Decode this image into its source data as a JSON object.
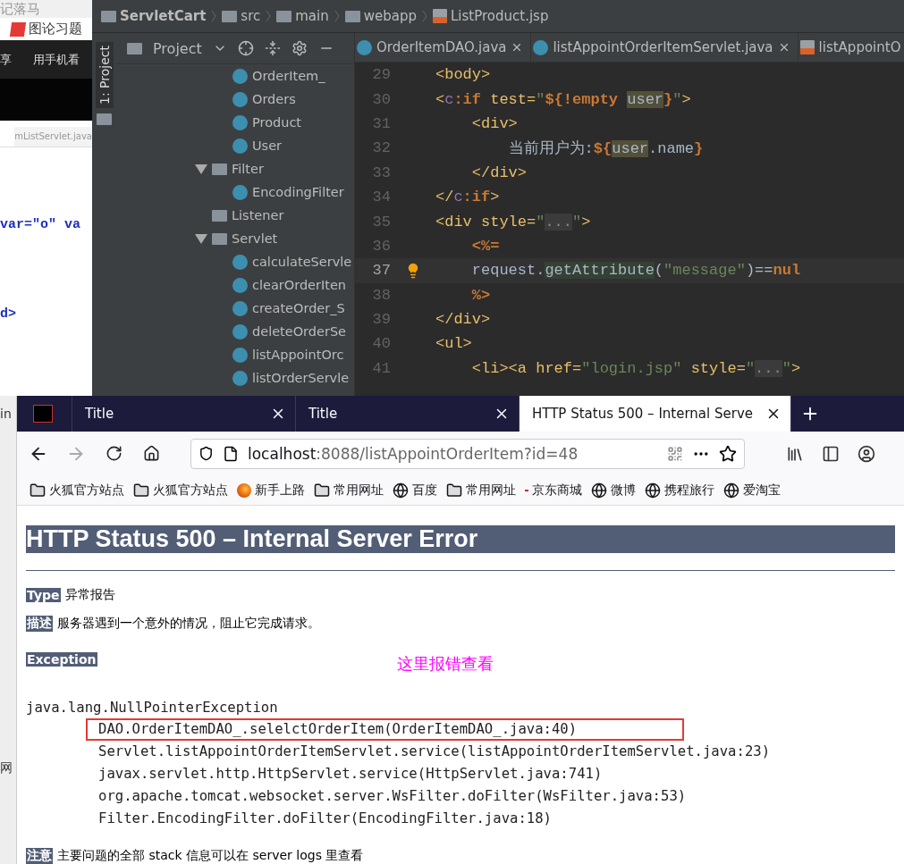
{
  "background_app": {
    "title_fragment": "记落马",
    "tab": "图论习题",
    "menu": [
      "享",
      "用手机看"
    ],
    "file_tab": "mListServlet.java",
    "code_lines": [
      "var=\"o\" va",
      "d>"
    ],
    "side_texts": [
      "in",
      "网"
    ]
  },
  "ide": {
    "breadcrumbs": [
      {
        "label": "ServletCart",
        "kind": "project"
      },
      {
        "label": "src",
        "kind": "folder"
      },
      {
        "label": "main",
        "kind": "folder"
      },
      {
        "label": "webapp",
        "kind": "web"
      },
      {
        "label": "ListProduct.jsp",
        "kind": "jsp"
      }
    ],
    "tool_window_tab": "1: Project",
    "project_panel": {
      "title": "Project",
      "tree": [
        {
          "label": "OrderItem_",
          "kind": "class"
        },
        {
          "label": "Orders",
          "kind": "class"
        },
        {
          "label": "Product",
          "kind": "class"
        },
        {
          "label": "User",
          "kind": "class"
        },
        {
          "label": "Filter",
          "kind": "folder",
          "expanded": true,
          "children": [
            {
              "label": "EncodingFilter",
              "kind": "class"
            }
          ]
        },
        {
          "label": "Listener",
          "kind": "folder"
        },
        {
          "label": "Servlet",
          "kind": "folder",
          "expanded": true,
          "children": [
            {
              "label": "calculateServle",
              "kind": "class"
            },
            {
              "label": "clearOrderIten",
              "kind": "class"
            },
            {
              "label": "createOrder_S",
              "kind": "class"
            },
            {
              "label": "deleteOrderSe",
              "kind": "class"
            },
            {
              "label": "listAppointOrc",
              "kind": "class"
            },
            {
              "label": "listOrderServle",
              "kind": "class"
            }
          ]
        }
      ]
    },
    "editor_tabs": [
      {
        "label": "OrderItemDAO.java",
        "kind": "class"
      },
      {
        "label": "listAppointOrderItemServlet.java",
        "kind": "class"
      },
      {
        "label": "listAppointO",
        "kind": "jsp"
      }
    ],
    "code": [
      {
        "number": "29",
        "current": false,
        "tokens": [
          {
            "kind": "tag",
            "t": "<body>"
          }
        ]
      },
      {
        "number": "30",
        "current": false,
        "tokens": [
          {
            "kind": "tag",
            "t": "<"
          },
          {
            "kind": "ns",
            "t": "c"
          },
          {
            "kind": "kw",
            "t": ":if"
          },
          {
            "kind": "tag",
            "t": " test="
          },
          {
            "kind": "str",
            "t": "\""
          },
          {
            "kind": "kw",
            "t": "${!empty "
          },
          {
            "kind": "hl",
            "t": "user"
          },
          {
            "kind": "kw",
            "t": "}"
          },
          {
            "kind": "str",
            "t": "\""
          },
          {
            "kind": "tag",
            "t": ">"
          }
        ]
      },
      {
        "number": "31",
        "current": false,
        "tokens": [
          {
            "kind": "tag",
            "t": "    <div>"
          }
        ]
      },
      {
        "number": "32",
        "current": false,
        "tokens": [
          {
            "kind": "text",
            "t": "        当前用户为:"
          },
          {
            "kind": "kw",
            "t": "${"
          },
          {
            "kind": "hl",
            "t": "user"
          },
          {
            "kind": "text",
            "t": ".name"
          },
          {
            "kind": "kw",
            "t": "}"
          }
        ]
      },
      {
        "number": "33",
        "current": false,
        "tokens": [
          {
            "kind": "tag",
            "t": "    </div>"
          }
        ]
      },
      {
        "number": "34",
        "current": false,
        "tokens": [
          {
            "kind": "tag",
            "t": "</"
          },
          {
            "kind": "ns",
            "t": "c"
          },
          {
            "kind": "kw",
            "t": ":if"
          },
          {
            "kind": "tag",
            "t": ">"
          }
        ]
      },
      {
        "number": "35",
        "current": false,
        "tokens": [
          {
            "kind": "tag",
            "t": "<div style="
          },
          {
            "kind": "str",
            "t": "\""
          },
          {
            "kind": "fold",
            "t": "..."
          },
          {
            "kind": "str",
            "t": "\""
          },
          {
            "kind": "tag",
            "t": ">"
          }
        ]
      },
      {
        "number": "36",
        "current": false,
        "tokens": [
          {
            "kind": "kw",
            "t": "    <%="
          }
        ]
      },
      {
        "number": "37",
        "current": true,
        "tokens": [
          {
            "kind": "text",
            "t": "    request."
          },
          {
            "kind": "method",
            "t": "getAttribute"
          },
          {
            "kind": "text",
            "t": "("
          },
          {
            "kind": "str",
            "t": "\"message\""
          },
          {
            "kind": "text",
            "t": ")=="
          },
          {
            "kind": "kw",
            "t": "nul"
          }
        ]
      },
      {
        "number": "38",
        "current": false,
        "tokens": [
          {
            "kind": "kw",
            "t": "    %>"
          }
        ]
      },
      {
        "number": "39",
        "current": false,
        "tokens": [
          {
            "kind": "tag",
            "t": "</div>"
          }
        ]
      },
      {
        "number": "40",
        "current": false,
        "tokens": [
          {
            "kind": "tag",
            "t": "<ul>"
          }
        ]
      },
      {
        "number": "41",
        "current": false,
        "tokens": [
          {
            "kind": "tag",
            "t": "    <li><a href="
          },
          {
            "kind": "str",
            "t": "\"login.jsp\""
          },
          {
            "kind": "tag",
            "t": " style="
          },
          {
            "kind": "str",
            "t": "\""
          },
          {
            "kind": "fold",
            "t": "..."
          },
          {
            "kind": "str",
            "t": "\""
          },
          {
            "kind": "tag",
            "t": ">"
          }
        ]
      }
    ]
  },
  "browser": {
    "tabs": [
      {
        "kind": "icon",
        "selected": false
      },
      {
        "kind": "page",
        "label": "Title",
        "selected": false
      },
      {
        "kind": "page",
        "label": "Title",
        "selected": false
      },
      {
        "kind": "page",
        "label": "HTTP Status 500 – Internal Serve",
        "selected": true
      }
    ],
    "nav_buttons": [
      {
        "kind": "back",
        "disabled": false
      },
      {
        "kind": "forward",
        "disabled": true
      },
      {
        "kind": "reload",
        "disabled": false
      },
      {
        "kind": "home",
        "disabled": false
      }
    ],
    "url": {
      "host": "localhost",
      "path": ":8088/listAppointOrderItem?id=48"
    },
    "bookmarks": [
      {
        "label": "火狐官方站点",
        "kind": "folder"
      },
      {
        "label": "火狐官方站点",
        "kind": "folder"
      },
      {
        "label": "新手上路",
        "kind": "firefox"
      },
      {
        "label": "常用网址",
        "kind": "folder"
      },
      {
        "label": "百度",
        "kind": "globe"
      },
      {
        "label": "常用网址",
        "kind": "folder"
      },
      {
        "label": "京东商城",
        "kind": "jd"
      },
      {
        "label": "微博",
        "kind": "globe"
      },
      {
        "label": "携程旅行",
        "kind": "globe"
      },
      {
        "label": "爱淘宝",
        "kind": "globe"
      }
    ],
    "page": {
      "heading": "HTTP Status 500 – Internal Server Error",
      "fields": [
        {
          "label": "Type",
          "value": "异常报告"
        },
        {
          "label": "描述",
          "value": "服务器遇到一个意外的情况，阻止它完成请求。"
        }
      ],
      "exception_label": "Exception",
      "annotation": "这里报错查看",
      "exception": "java.lang.NullPointerException",
      "frames": [
        {
          "text": "DAO.OrderItemDAO_.selelctOrderItem(OrderItemDAO_.java:40)",
          "highlighted": true
        },
        {
          "text": "Servlet.listAppointOrderItemServlet.service(listAppointOrderItemServlet.java:23)",
          "highlighted": false
        },
        {
          "text": "javax.servlet.http.HttpServlet.service(HttpServlet.java:741)",
          "highlighted": false
        },
        {
          "text": "org.apache.tomcat.websocket.server.WsFilter.doFilter(WsFilter.java:53)",
          "highlighted": false
        },
        {
          "text": "Filter.EncodingFilter.doFilter(EncodingFilter.java:18)",
          "highlighted": false
        }
      ],
      "note": {
        "label": "注意",
        "text": "主要问题的全部 stack 信息可以在 server logs 里查看"
      }
    }
  }
}
